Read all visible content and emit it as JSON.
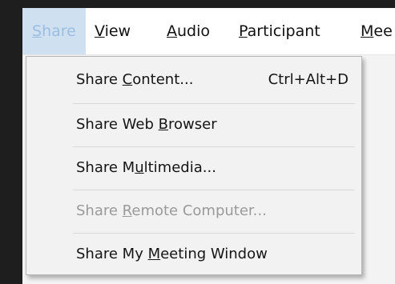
{
  "menubar": {
    "items": [
      {
        "pre": "",
        "ul": "S",
        "post": "hare",
        "active": true
      },
      {
        "pre": "",
        "ul": "V",
        "post": "iew"
      },
      {
        "pre": "",
        "ul": "A",
        "post": "udio"
      },
      {
        "pre": "",
        "ul": "P",
        "post": "articipant"
      },
      {
        "pre": "",
        "ul": "M",
        "post": "ee"
      }
    ]
  },
  "share_menu": {
    "items": [
      {
        "pre": "Share ",
        "ul": "C",
        "post": "ontent...",
        "shortcut": "Ctrl+Alt+D",
        "enabled": true
      },
      {
        "pre": "Share Web ",
        "ul": "B",
        "post": "rowser",
        "enabled": true
      },
      {
        "pre": "Share M",
        "ul": "u",
        "post": "ltimedia...",
        "enabled": true
      },
      {
        "pre": "Share ",
        "ul": "R",
        "post": "emote Computer...",
        "enabled": false
      },
      {
        "pre": "Share My ",
        "ul": "M",
        "post": "eeting Window",
        "enabled": true
      }
    ]
  }
}
